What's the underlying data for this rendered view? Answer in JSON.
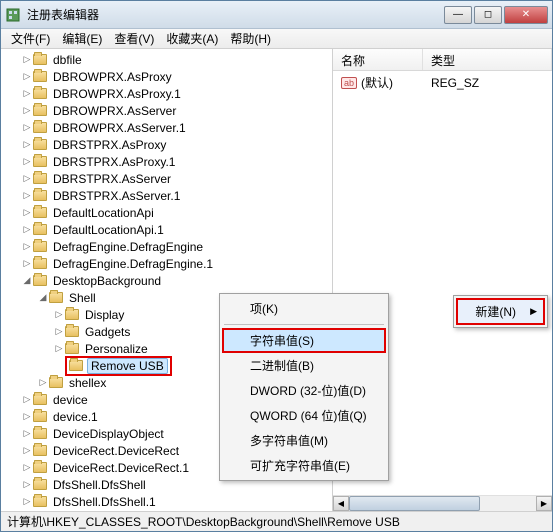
{
  "title": "注册表编辑器",
  "menubar": [
    "文件(F)",
    "编辑(E)",
    "查看(V)",
    "收藏夹(A)",
    "帮助(H)"
  ],
  "tree": [
    {
      "label": "dbfile",
      "exp": "▷",
      "indent": 1
    },
    {
      "label": "DBROWPRX.AsProxy",
      "exp": "▷",
      "indent": 1
    },
    {
      "label": "DBROWPRX.AsProxy.1",
      "exp": "▷",
      "indent": 1
    },
    {
      "label": "DBROWPRX.AsServer",
      "exp": "▷",
      "indent": 1
    },
    {
      "label": "DBROWPRX.AsServer.1",
      "exp": "▷",
      "indent": 1
    },
    {
      "label": "DBRSTPRX.AsProxy",
      "exp": "▷",
      "indent": 1
    },
    {
      "label": "DBRSTPRX.AsProxy.1",
      "exp": "▷",
      "indent": 1
    },
    {
      "label": "DBRSTPRX.AsServer",
      "exp": "▷",
      "indent": 1
    },
    {
      "label": "DBRSTPRX.AsServer.1",
      "exp": "▷",
      "indent": 1
    },
    {
      "label": "DefaultLocationApi",
      "exp": "▷",
      "indent": 1
    },
    {
      "label": "DefaultLocationApi.1",
      "exp": "▷",
      "indent": 1
    },
    {
      "label": "DefragEngine.DefragEngine",
      "exp": "▷",
      "indent": 1
    },
    {
      "label": "DefragEngine.DefragEngine.1",
      "exp": "▷",
      "indent": 1
    },
    {
      "label": "DesktopBackground",
      "exp": "◢",
      "indent": 1
    },
    {
      "label": "Shell",
      "exp": "◢",
      "indent": 2
    },
    {
      "label": "Display",
      "exp": "▷",
      "indent": 3
    },
    {
      "label": "Gadgets",
      "exp": "▷",
      "indent": 3
    },
    {
      "label": "Personalize",
      "exp": "▷",
      "indent": 3
    },
    {
      "label": "Remove USB",
      "exp": "",
      "indent": 3,
      "sel": true,
      "red": true
    },
    {
      "label": "shellex",
      "exp": "▷",
      "indent": 2
    },
    {
      "label": "device",
      "exp": "▷",
      "indent": 1
    },
    {
      "label": "device.1",
      "exp": "▷",
      "indent": 1
    },
    {
      "label": "DeviceDisplayObject",
      "exp": "▷",
      "indent": 1
    },
    {
      "label": "DeviceRect.DeviceRect",
      "exp": "▷",
      "indent": 1
    },
    {
      "label": "DeviceRect.DeviceRect.1",
      "exp": "▷",
      "indent": 1
    },
    {
      "label": "DfsShell.DfsShell",
      "exp": "▷",
      "indent": 1
    },
    {
      "label": "DfsShell.DfsShell.1",
      "exp": "▷",
      "indent": 1
    }
  ],
  "cols": {
    "name": "名称",
    "type": "类型"
  },
  "row": {
    "icon": "ab",
    "name": "(默认)",
    "type": "REG_SZ"
  },
  "ctx1": [
    {
      "label": "项(K)",
      "sep": true
    },
    {
      "label": "字符串值(S)",
      "hl": true,
      "red": true
    },
    {
      "label": "二进制值(B)"
    },
    {
      "label": "DWORD (32-位)值(D)"
    },
    {
      "label": "QWORD (64 位)值(Q)"
    },
    {
      "label": "多字符串值(M)"
    },
    {
      "label": "可扩充字符串值(E)"
    }
  ],
  "new_item": {
    "label": "新建(N)",
    "arrow": "▶"
  },
  "status": "计算机\\HKEY_CLASSES_ROOT\\DesktopBackground\\Shell\\Remove USB"
}
